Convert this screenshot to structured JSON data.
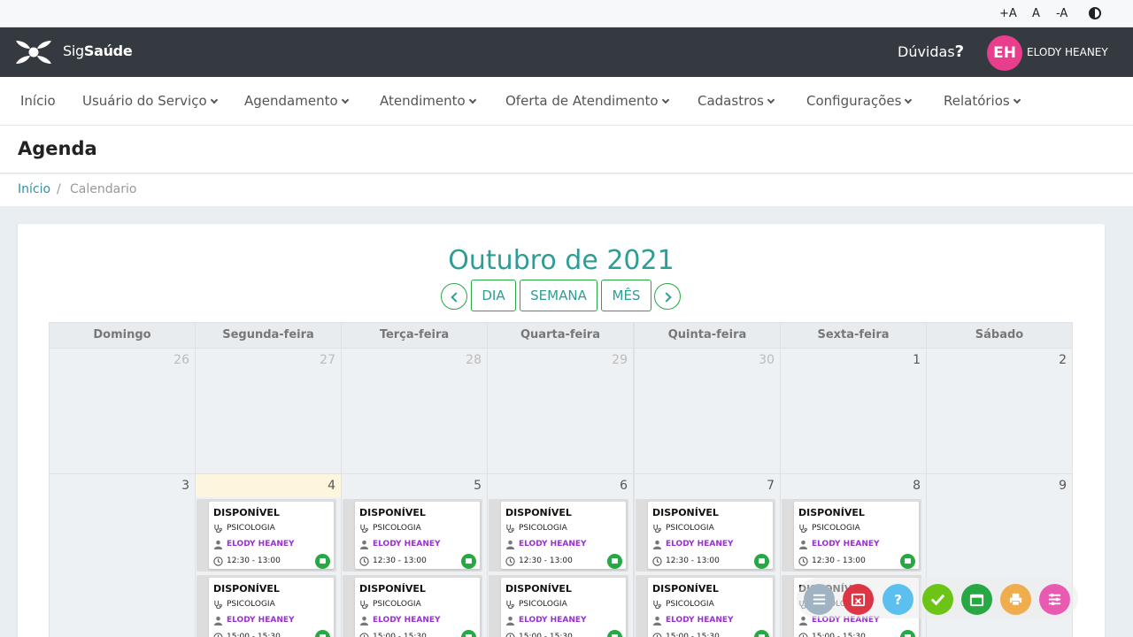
{
  "accessibility": {
    "increase": "+A",
    "normal": "A",
    "decrease": "-A"
  },
  "header": {
    "brand_prefix": "Sig",
    "brand_suffix": "Saúde",
    "help_label": "Dúvidas",
    "help_mark": "?",
    "user_initials": "EH",
    "user_name": "ELODY HEANEY",
    "avatar_color": "#e83e8c"
  },
  "nav": {
    "items": [
      {
        "label": "Início",
        "dropdown": false
      },
      {
        "label": "Usuário do Serviço",
        "dropdown": true
      },
      {
        "label": "Agendamento",
        "dropdown": true
      },
      {
        "label": "Atendimento",
        "dropdown": true
      },
      {
        "label": "Oferta de Atendimento",
        "dropdown": true
      },
      {
        "label": "Cadastros",
        "dropdown": true
      },
      {
        "label": "Configurações",
        "dropdown": true
      },
      {
        "label": "Relatórios",
        "dropdown": true
      }
    ]
  },
  "page": {
    "title": "Agenda",
    "breadcrumb": {
      "home": "Início",
      "separator": "/",
      "current": "Calendario"
    }
  },
  "calendar": {
    "month_title": "Outubro de 2021",
    "views": {
      "day": "DIA",
      "week": "SEMANA",
      "month": "MÊS"
    },
    "weekdays": [
      "Domingo",
      "Segunda-feira",
      "Terça-feira",
      "Quarta-feira",
      "Quinta-feira",
      "Sexta-feira",
      "Sábado"
    ],
    "week1": [
      "26",
      "27",
      "28",
      "29",
      "30",
      "1",
      "2"
    ],
    "week2": [
      "3",
      "4",
      "5",
      "6",
      "7",
      "8",
      "9"
    ],
    "slot": {
      "status": "DISPONÍVEL",
      "specialty": "PSICOLOGIA",
      "professional": "ELODY HEANEY",
      "time_1": "12:30 - 13:00",
      "time_2": "15:00 - 15:30"
    },
    "accent_color": "#2e9e94"
  },
  "actions": [
    "list-icon",
    "calendar-remove-icon",
    "question-icon",
    "check-icon",
    "calendar-icon",
    "print-icon",
    "filter-icon"
  ]
}
